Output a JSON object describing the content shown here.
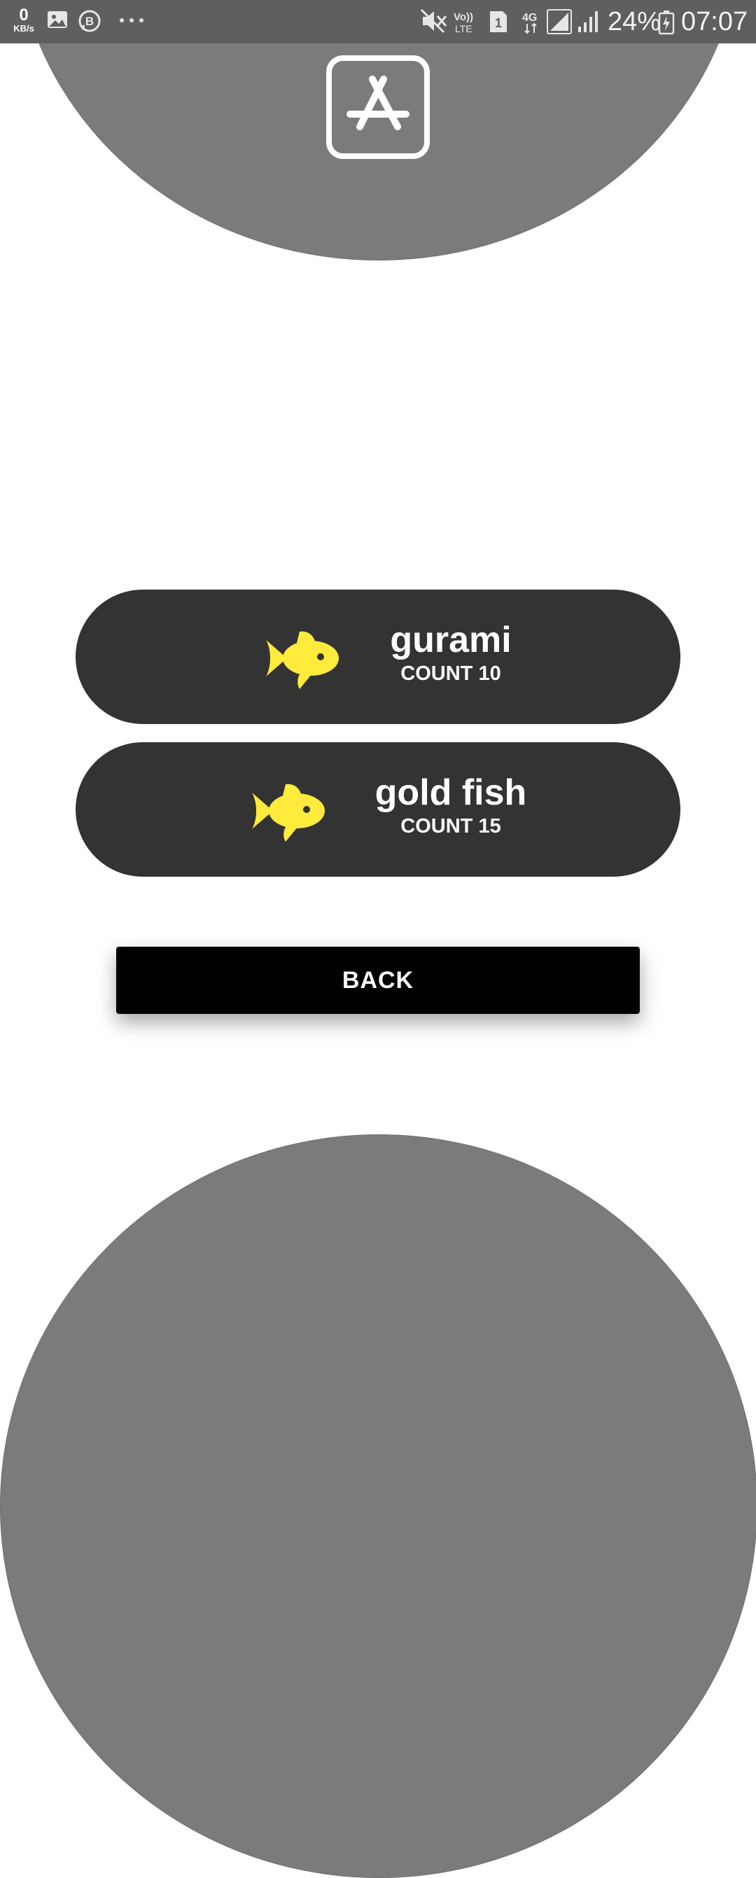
{
  "status_bar": {
    "net_speed_value": "0",
    "net_speed_unit": "KB/s",
    "battery_percent": "24%",
    "time": "07:07",
    "sim_slot": "1",
    "network_type": "4G",
    "volte_label": "Vo)) LTE",
    "icons": [
      "image-icon",
      "b-chat-icon",
      "more-dots-icon",
      "mute-icon",
      "volte-icon",
      "sim-icon",
      "data-4g-icon",
      "signal-icon",
      "signal-icon-2",
      "battery-icon"
    ]
  },
  "header": {
    "logo_icon": "app-store-icon"
  },
  "fish_list": [
    {
      "name": "gurami",
      "count_label": "COUNT 10",
      "icon": "fish-icon",
      "icon_color": "#FFEB3B"
    },
    {
      "name": "gold fish",
      "count_label": "COUNT 15",
      "icon": "fish-icon",
      "icon_color": "#FFEB3B"
    }
  ],
  "actions": {
    "back_label": "BACK"
  },
  "colors": {
    "background": "#FFFFFF",
    "circle": "#7B7B7B",
    "card": "#333333",
    "accent": "#FFEB3B",
    "button": "#000000"
  }
}
